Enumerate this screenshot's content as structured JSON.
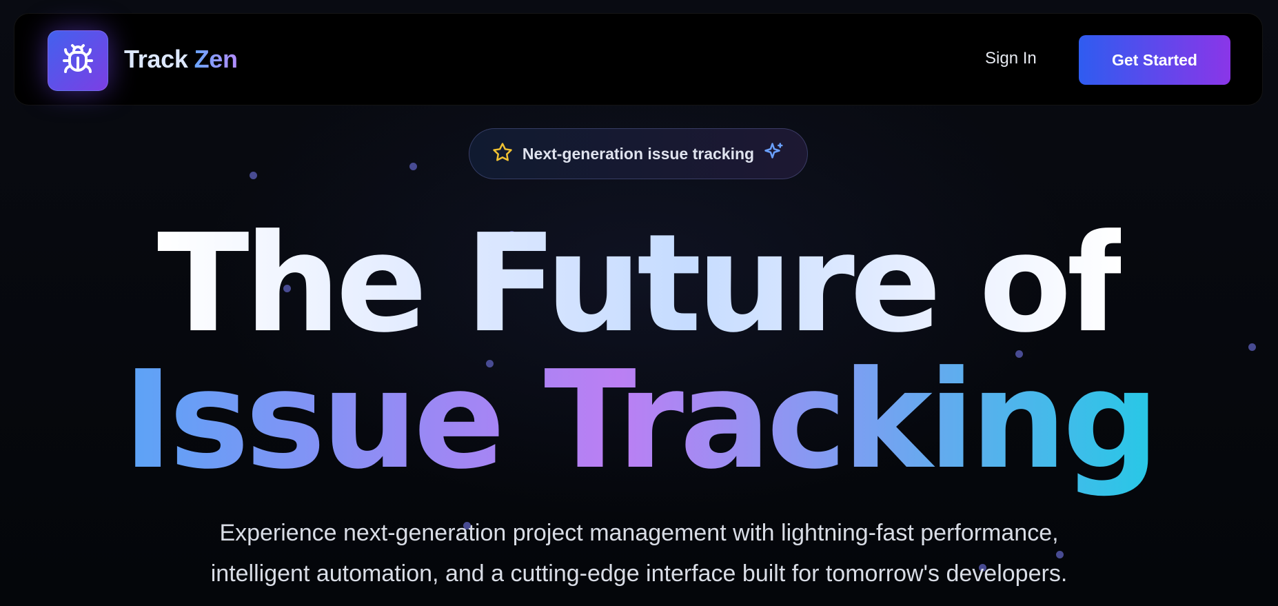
{
  "nav": {
    "brand_primary": "Track",
    "brand_secondary": "Zen",
    "logo_icon": "bug-icon",
    "sign_in": "Sign In",
    "get_started": "Get Started"
  },
  "badge": {
    "text": "Next-generation issue tracking",
    "left_icon": "star-icon",
    "right_icon": "sparkles-icon"
  },
  "hero": {
    "line1": "The Future of",
    "line2": "Issue Tracking",
    "subtitle_line1": "Experience next-generation project management with lightning-fast performance,",
    "subtitle_line2": "intelligent automation, and a cutting-edge interface built for tomorrow's developers."
  },
  "colors": {
    "accent_blue": "#2f5cf0",
    "accent_purple": "#8a36e8",
    "background": "#05070c"
  }
}
